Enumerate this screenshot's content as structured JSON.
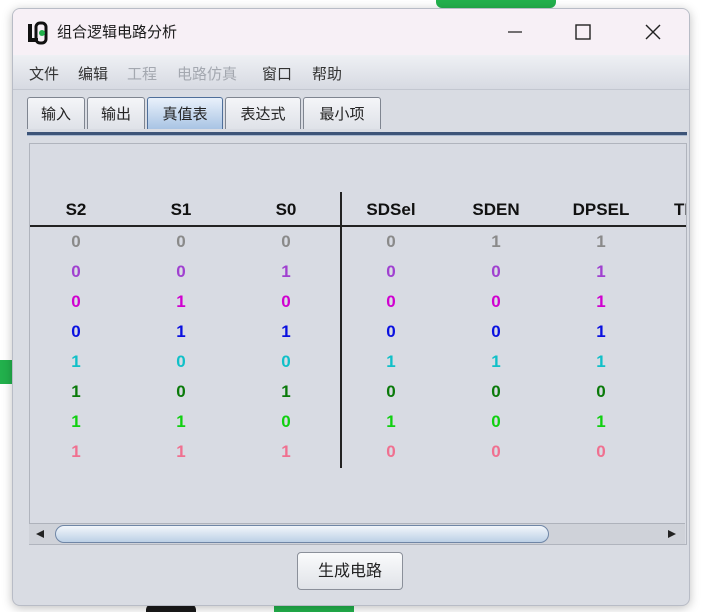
{
  "window": {
    "title": "组合逻辑电路分析"
  },
  "menu": [
    {
      "label": "文件",
      "enabled": true
    },
    {
      "label": "编辑",
      "enabled": true
    },
    {
      "label": "工程",
      "enabled": false
    },
    {
      "label": "电路仿真",
      "enabled": false
    },
    {
      "label": "窗口",
      "enabled": true
    },
    {
      "label": "帮助",
      "enabled": true
    }
  ],
  "tabs": [
    "输入",
    "输出",
    "真值表",
    "表达式",
    "最小项"
  ],
  "active_tab": "真值表",
  "table": {
    "input_headers": [
      "S2",
      "S1",
      "S0"
    ],
    "output_headers": [
      "SDSel",
      "SDEN",
      "DPSEL",
      "TM"
    ],
    "rows": [
      {
        "color": "#8a8a8a",
        "inputs": [
          "0",
          "0",
          "0"
        ],
        "outputs": [
          "0",
          "1",
          "1"
        ]
      },
      {
        "color": "#a040d0",
        "inputs": [
          "0",
          "0",
          "1"
        ],
        "outputs": [
          "0",
          "0",
          "1"
        ]
      },
      {
        "color": "#d000d0",
        "inputs": [
          "0",
          "1",
          "0"
        ],
        "outputs": [
          "0",
          "0",
          "1"
        ]
      },
      {
        "color": "#0a10e0",
        "inputs": [
          "0",
          "1",
          "1"
        ],
        "outputs": [
          "0",
          "0",
          "1"
        ]
      },
      {
        "color": "#10c0c8",
        "inputs": [
          "1",
          "0",
          "0"
        ],
        "outputs": [
          "1",
          "1",
          "1"
        ]
      },
      {
        "color": "#0a7a0a",
        "inputs": [
          "1",
          "0",
          "1"
        ],
        "outputs": [
          "0",
          "0",
          "0"
        ]
      },
      {
        "color": "#10d010",
        "inputs": [
          "1",
          "1",
          "0"
        ],
        "outputs": [
          "1",
          "0",
          "1"
        ]
      },
      {
        "color": "#f07090",
        "inputs": [
          "1",
          "1",
          "1"
        ],
        "outputs": [
          "0",
          "0",
          "0"
        ]
      }
    ]
  },
  "generate_button": "生成电路"
}
